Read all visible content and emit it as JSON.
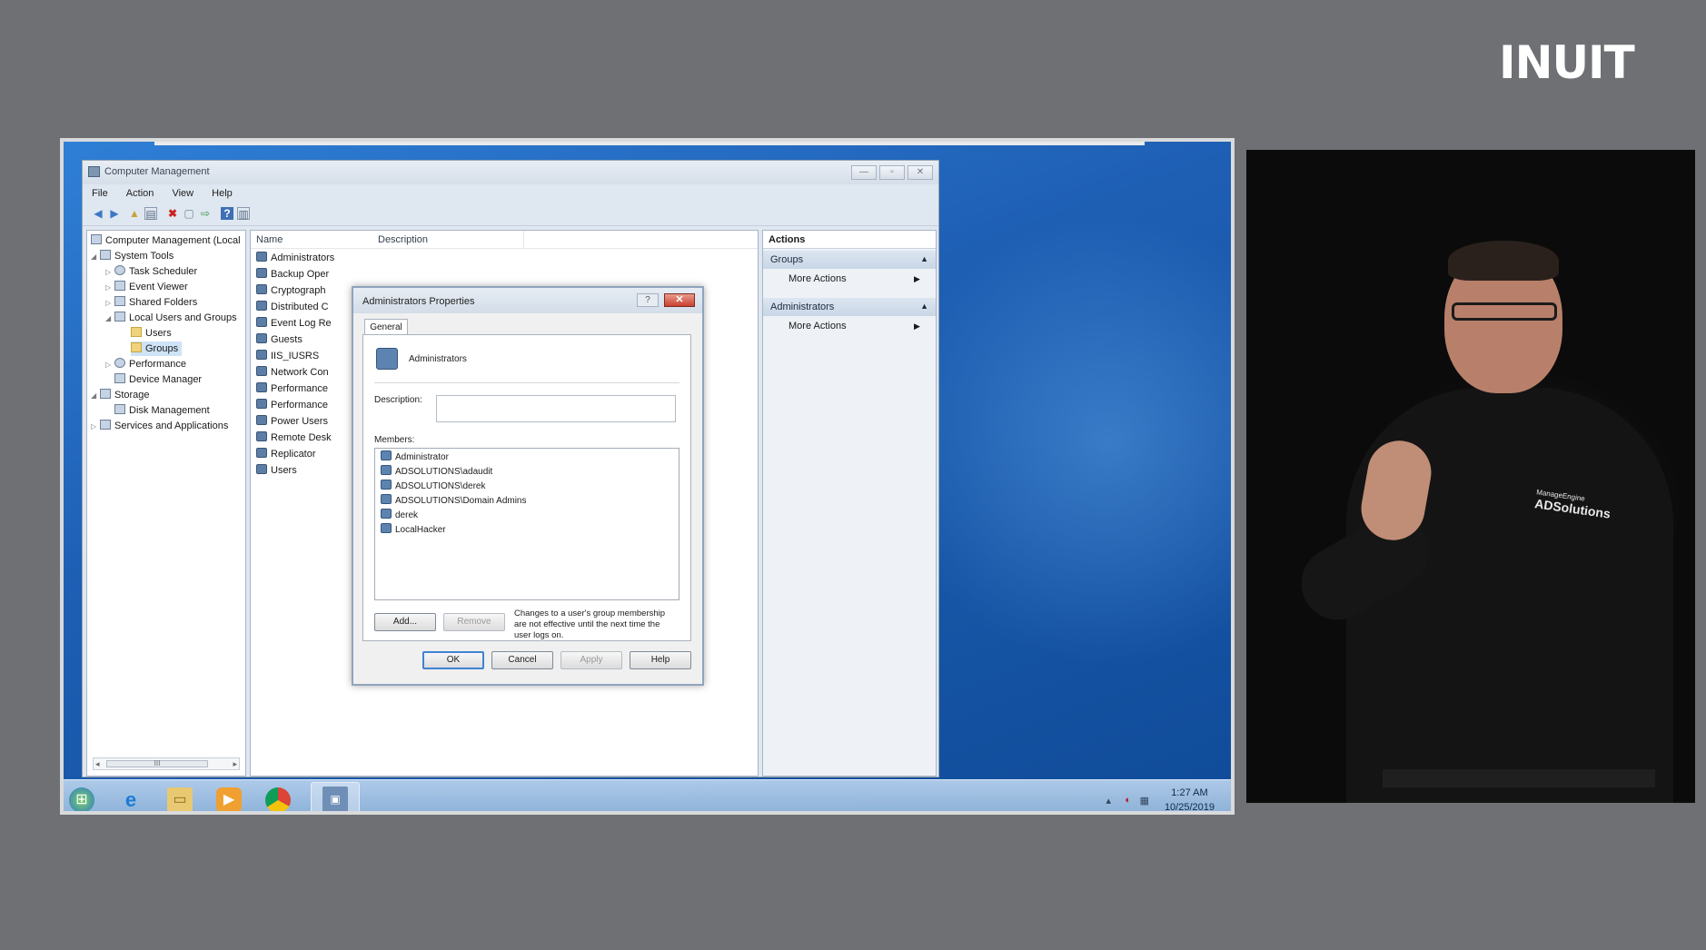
{
  "brand": {
    "name": "INUIT",
    "color": "#ffffff"
  },
  "window": {
    "title": "Computer Management",
    "controls": {
      "minimize": "—",
      "maximize": "▫",
      "close": "✕"
    },
    "menu": [
      "File",
      "Action",
      "View",
      "Help"
    ]
  },
  "tree": {
    "items": [
      {
        "label": "Computer Management (Local",
        "icon": "computer-icon",
        "level": 0,
        "expanded": "none"
      },
      {
        "label": "System Tools",
        "icon": "tools-icon",
        "level": 1,
        "expanded": "down"
      },
      {
        "label": "Task Scheduler",
        "icon": "clock-icon",
        "level": 2,
        "expanded": "right"
      },
      {
        "label": "Event Viewer",
        "icon": "event-viewer-icon",
        "level": 2,
        "expanded": "right"
      },
      {
        "label": "Shared Folders",
        "icon": "shared-folder-icon",
        "level": 2,
        "expanded": "right"
      },
      {
        "label": "Local Users and Groups",
        "icon": "users-icon",
        "level": 2,
        "expanded": "down"
      },
      {
        "label": "Users",
        "icon": "folder-icon",
        "level": 3,
        "expanded": "none"
      },
      {
        "label": "Groups",
        "icon": "folder-icon",
        "level": 3,
        "expanded": "none",
        "selected": true
      },
      {
        "label": "Performance",
        "icon": "performance-icon",
        "level": 2,
        "expanded": "right"
      },
      {
        "label": "Device Manager",
        "icon": "device-manager-icon",
        "level": 2,
        "expanded": "none"
      },
      {
        "label": "Storage",
        "icon": "storage-icon",
        "level": 1,
        "expanded": "down"
      },
      {
        "label": "Disk Management",
        "icon": "disk-icon",
        "level": 2,
        "expanded": "none"
      },
      {
        "label": "Services and Applications",
        "icon": "services-icon",
        "level": 1,
        "expanded": "right"
      }
    ],
    "scrollbar_grip": "III"
  },
  "list": {
    "columns": [
      "Name",
      "Description"
    ],
    "items": [
      "Administrators",
      "Backup Oper",
      "Cryptograph",
      "Distributed C",
      "Event Log Re",
      "Guests",
      "IIS_IUSRS",
      "Network Con",
      "Performance",
      "Performance",
      "Power Users",
      "Remote Desk",
      "Replicator",
      "Users"
    ]
  },
  "actions": {
    "title": "Actions",
    "sections": [
      {
        "label": "Groups",
        "action": "More Actions"
      },
      {
        "label": "Administrators",
        "action": "More Actions"
      }
    ]
  },
  "dialog": {
    "title": "Administrators Properties",
    "help_glyph": "?",
    "close_glyph": "✕",
    "tab": "General",
    "group_name": "Administrators",
    "description_label": "Description:",
    "description_value": "",
    "members_label": "Members:",
    "members": [
      "Administrator",
      "ADSOLUTIONS\\adaudit",
      "ADSOLUTIONS\\derek",
      "ADSOLUTIONS\\Domain Admins",
      "derek",
      "LocalHacker"
    ],
    "add_button": "Add...",
    "remove_button": "Remove",
    "note": "Changes to a user's group membership are not effective until the next time the user logs on.",
    "ok_button": "OK",
    "cancel_button": "Cancel",
    "apply_button": "Apply",
    "help_button": "Help"
  },
  "taskbar": {
    "icons": [
      "start-orb-icon",
      "internet-explorer-icon",
      "file-explorer-icon",
      "media-player-icon",
      "chrome-icon",
      "computer-management-icon"
    ],
    "time": "1:27 AM",
    "date": "10/25/2019"
  },
  "presenter": {
    "shirt_logo_top": "ManageEngine",
    "shirt_logo": "ADSolutions"
  }
}
